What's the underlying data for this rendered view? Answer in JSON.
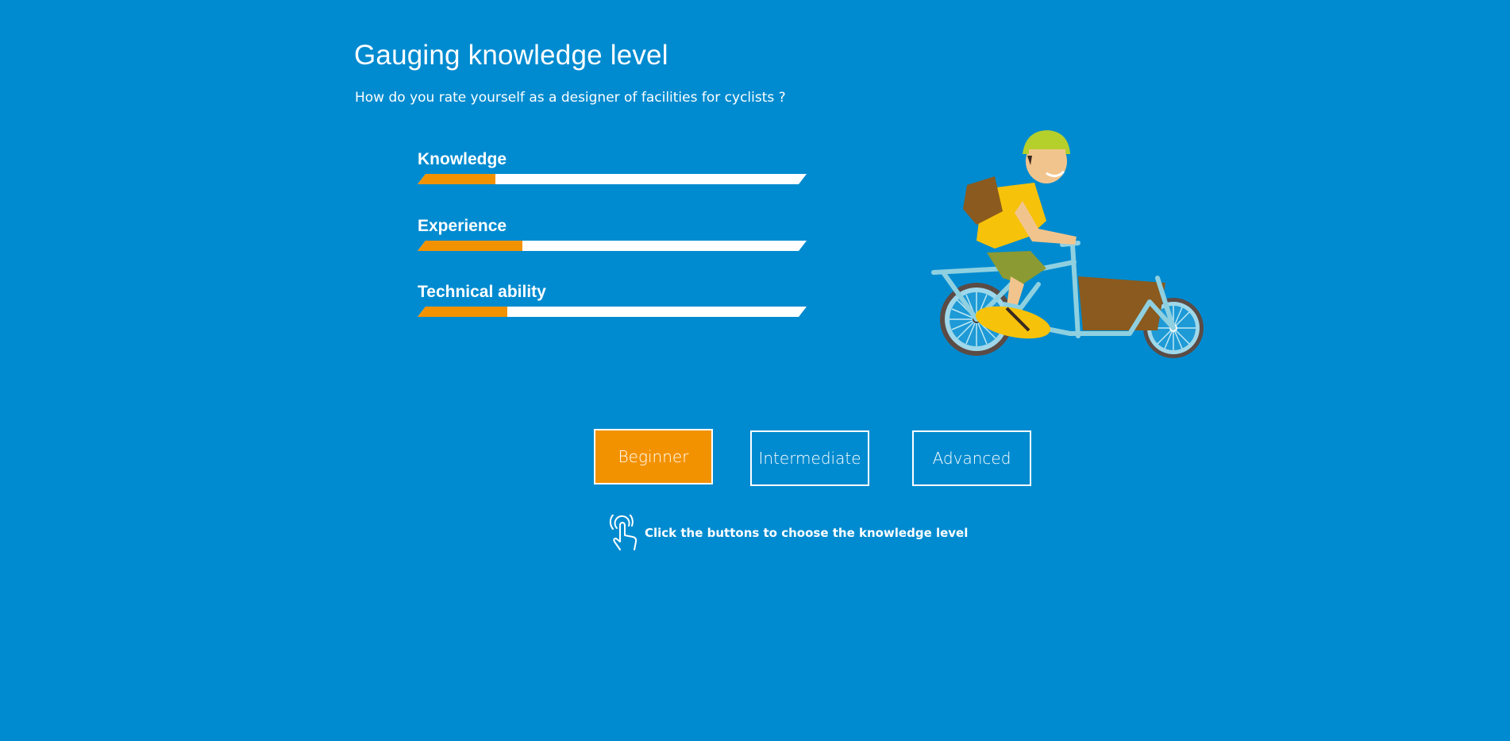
{
  "page": {
    "title": "Gauging knowledge level",
    "question": "How do you rate yourself as a designer of facilities for cyclists ?"
  },
  "meters": [
    {
      "label": "Knowledge",
      "level": 0.2
    },
    {
      "label": "Experience",
      "level": 0.27
    },
    {
      "label": "Technical ability",
      "level": 0.23
    }
  ],
  "buttons": {
    "beginner": "Beginner",
    "intermediate": "Intermediate",
    "advanced": "Advanced",
    "selected": "Beginner"
  },
  "hint": {
    "text": "Click the buttons to choose the knowledge level",
    "icon": "touch-pointer-icon"
  },
  "colors": {
    "background": "#008bd0",
    "accent": "#f39200",
    "track": "#ffffff"
  }
}
